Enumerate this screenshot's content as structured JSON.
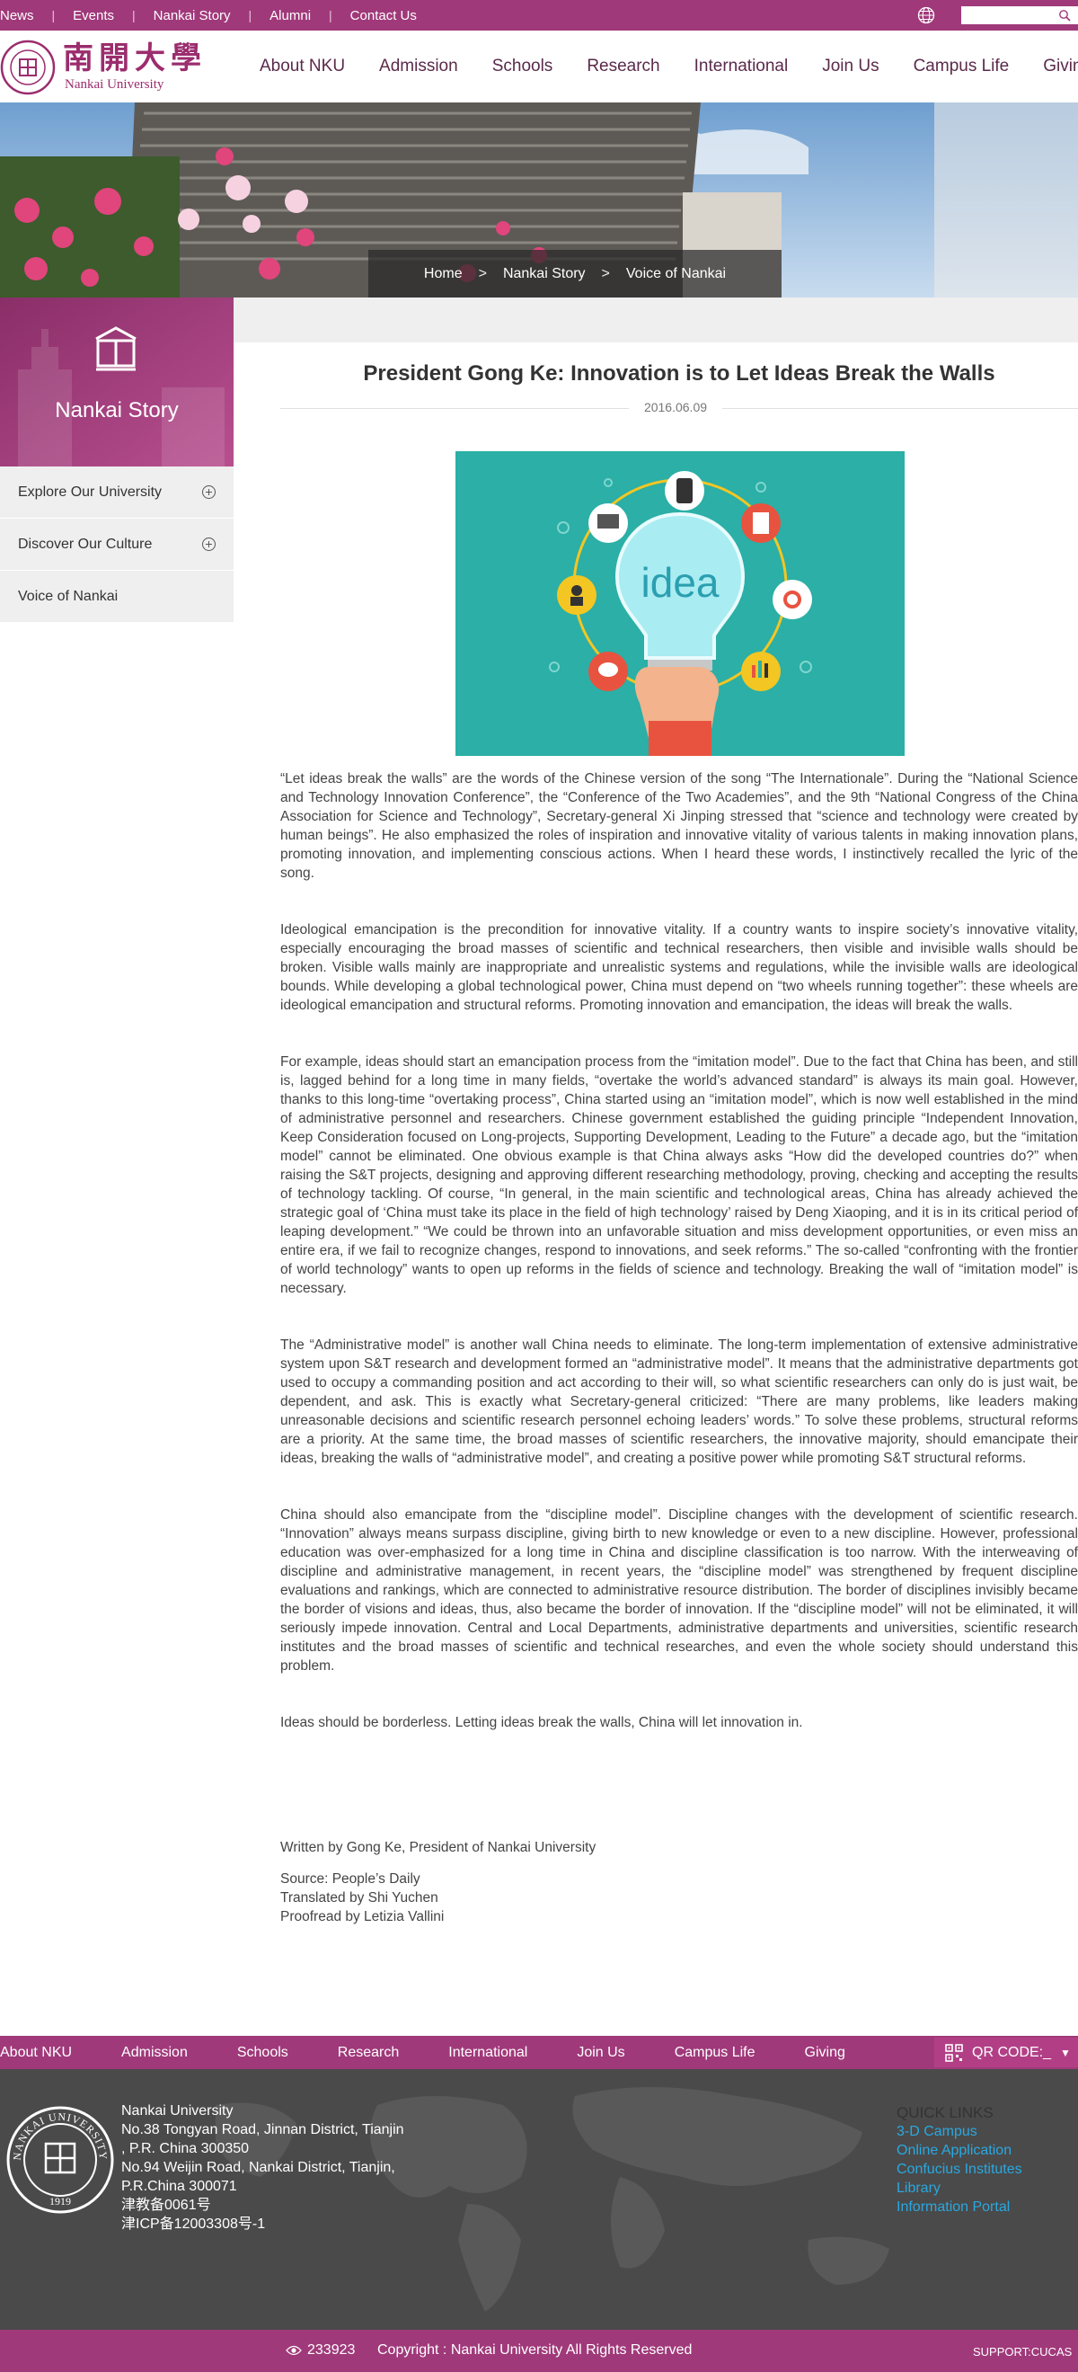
{
  "topbar": {
    "links": [
      "News",
      "Events",
      "Nankai Story",
      "Alumni",
      "Contact Us"
    ],
    "globe_icon": "globe-icon",
    "search_placeholder": "",
    "search_icon": "search-icon"
  },
  "header": {
    "logo_cn": "南開大學",
    "logo_en": "Nankai University",
    "nav": [
      "About NKU",
      "Admission",
      "Schools",
      "Research",
      "International",
      "Join Us",
      "Campus Life",
      "Giving"
    ]
  },
  "breadcrumb": {
    "items": [
      "Home",
      "Nankai Story",
      "Voice of Nankai"
    ],
    "separator": ">"
  },
  "sidebar": {
    "title": "Nankai Story",
    "items": [
      {
        "label": "Explore Our University",
        "expandable": true
      },
      {
        "label": "Discover Our Culture",
        "expandable": true
      },
      {
        "label": "Voice of Nankai",
        "expandable": false
      }
    ]
  },
  "article": {
    "title": "President Gong Ke: Innovation is to Let Ideas Break the Walls",
    "date": "2016.06.09",
    "image_word": "idea",
    "paragraphs": [
      "“Let ideas break the walls” are the words of the Chinese version of the song “The Internationale”. During the “National Science and Technology Innovation Conference”, the “Conference of the Two Academies”, and the 9th “National Congress of the China Association for Science and Technology”, Secretary-general Xi Jinping stressed that “science and technology were created by human beings”. He also emphasized the roles of inspiration and innovative vitality of various talents in making innovation plans, promoting innovation, and implementing conscious actions. When I heard these words, I instinctively recalled the lyric of the song.",
      "Ideological emancipation is the precondition for innovative vitality. If a country wants to inspire society’s innovative vitality, especially encouraging the broad masses of scientific and technical researchers, then visible and invisible walls should be broken. Visible walls mainly are inappropriate and unrealistic systems and regulations, while the invisible walls are ideological bounds. While developing a global technological power, China must depend on “two wheels running together”: these wheels are ideological emancipation and structural reforms. Promoting innovation and emancipation, the ideas will break the walls.",
      "For example, ideas should start an emancipation process from the “imitation model”. Due to the fact that China has been, and still is, lagged behind for a long time in many fields, “overtake the world’s advanced standard” is always its main goal. However, thanks to this long-time “overtaking process”, China started using an “imitation model”, which is now well established in the mind of administrative personnel and researchers. Chinese government established the guiding principle “Independent Innovation, Keep Consideration focused on Long-projects, Supporting Development, Leading to the Future” a decade ago, but the “imitation model” cannot be eliminated. One obvious example is that China always asks “How did the developed countries do?” when raising the S&T projects, designing and approving different researching methodology, proving, checking and accepting the results of technology tackling. Of course, “In general, in the main scientific and technological areas, China has already achieved the strategic goal of ‘China must take its place in the field of high technology’ raised by Deng Xiaoping, and it is in its critical period of leaping development.” “We could be thrown into an unfavorable situation and miss development opportunities, or even miss an entire era, if we fail to recognize changes, respond to innovations, and seek reforms.” The so-called “confronting with the frontier of world technology” wants to open up reforms in the fields of science and technology. Breaking the wall of “imitation model” is necessary.",
      "The “Administrative model” is another wall China needs to eliminate. The long-term implementation of extensive administrative system upon S&T research and development formed an “administrative model”. It means that the administrative departments got used to occupy a commanding position and act according to their will, so what scientific researchers can only do is just wait, be dependent, and ask. This is exactly what Secretary-general criticized: “There are many problems, like leaders making unreasonable decisions and scientific research personnel echoing leaders’ words.” To solve these problems, structural reforms are a priority. At the same time, the broad masses of scientific researchers, the innovative majority, should emancipate their ideas, breaking the walls of “administrative model”, and creating a positive power while promoting S&T structural reforms.",
      "China should also emancipate from the “discipline model”. Discipline changes with the development of scientific research. “Innovation” always means surpass discipline, giving birth to new knowledge or even to a new discipline. However, professional education was over-emphasized for a long time in China and discipline classification is too narrow. With the interweaving of discipline and administrative management, in recent years, the “discipline model” was strengthened by frequent discipline evaluations and rankings, which are connected to administrative resource distribution. The border of disciplines invisibly became the border of visions and ideas, thus, also became the border of innovation. If the “discipline model” will not be eliminated, it will seriously impede innovation. Central and Local Departments, administrative departments and universities, scientific research institutes and the broad masses of scientific and technical researches, and even the whole society should understand this problem.",
      "Ideas should be borderless. Letting ideas break the walls, China will let innovation in."
    ],
    "author_line": "Written by Gong Ke, President of Nankai University",
    "source": "Source: People’s Daily",
    "translator": "Translated by Shi Yuchen",
    "proofreader": "Proofread by Letizia Vallini"
  },
  "footer_nav": {
    "items": [
      "About NKU",
      "Admission",
      "Schools",
      "Research",
      "International",
      "Join Us",
      "Campus Life",
      "Giving"
    ],
    "qr_label": "QR CODE:_"
  },
  "footer": {
    "emblem_year": "1919",
    "emblem_text": "NANKAI UNIVERSITY",
    "address_lines": [
      "Nankai University",
      "No.38 Tongyan Road, Jinnan District, Tianjin",
      ", P.R. China 300350",
      "No.94 Weijin Road,  Nankai District, Tianjin,",
      "P.R.China  300071",
      "津教备0061号",
      "津ICP备12003308号-1"
    ],
    "quick_links_title": "QUICK LINKS",
    "quick_links": [
      "3-D Campus",
      "Online Application",
      "Confucius Institutes",
      "Library",
      "Information Portal"
    ]
  },
  "copyright_bar": {
    "visit_count": "233923",
    "copyright": "Copyright : Nankai University All Rights Reserved",
    "support": "SUPPORT:CUCAS"
  },
  "colors": {
    "brand_purple": "#a0397a",
    "link_blue": "#2aa8e0",
    "footer_grey": "#4a4a4a"
  }
}
